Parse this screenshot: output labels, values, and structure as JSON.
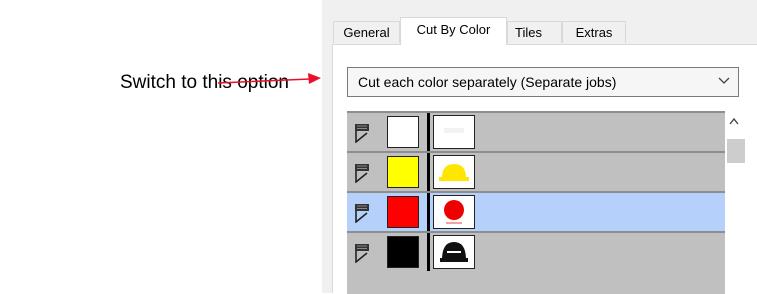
{
  "annotation": {
    "text": "Switch to this option",
    "arrow_color": "#e8102a"
  },
  "tabs": [
    {
      "label": "General",
      "active": false
    },
    {
      "label": "Cut By Color",
      "active": true
    },
    {
      "label": "Tiles",
      "active": false
    },
    {
      "label": "Extras",
      "active": false
    }
  ],
  "dropdown": {
    "value": "Cut each color separately (Separate jobs)",
    "icon": "chevron-down-icon"
  },
  "color_list": [
    {
      "color": "#ffffff",
      "thumbnail": "white-layer-thumbnail",
      "selected": false
    },
    {
      "color": "#ffff00",
      "thumbnail": "yellow-hat-thumbnail",
      "selected": false
    },
    {
      "color": "#ff0000",
      "thumbnail": "red-circle-thumbnail",
      "selected": true
    },
    {
      "color": "#000000",
      "thumbnail": "black-logo-thumbnail",
      "selected": false
    }
  ],
  "scrollbar": {
    "icon": "chevron-up-icon"
  }
}
